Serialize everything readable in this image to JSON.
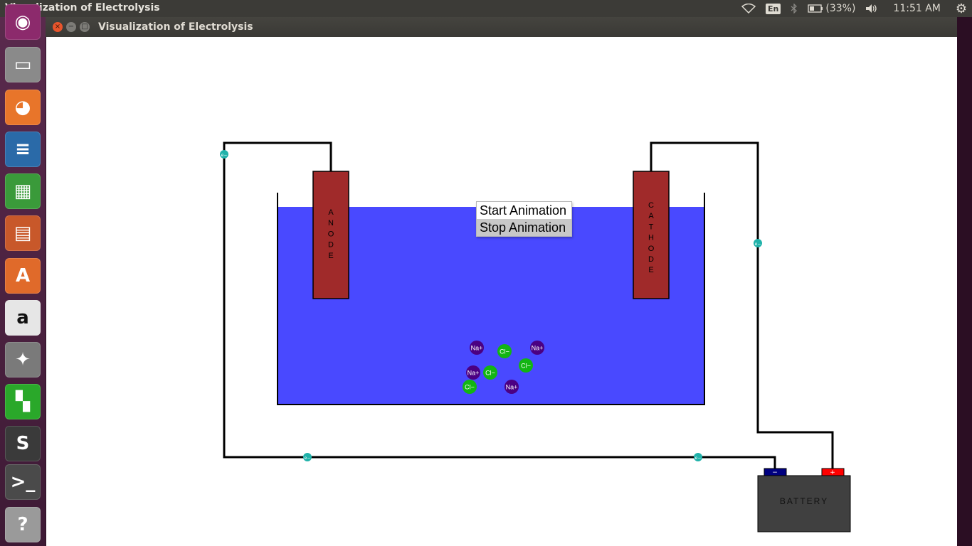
{
  "topbar": {
    "app_title": "Visualization of Electrolysis",
    "lang": "En",
    "battery": "(33%)",
    "time": "11:51 AM",
    "icons": [
      "wifi-icon",
      "bluetooth-icon",
      "battery-icon",
      "volume-icon",
      "settings-gear-icon"
    ]
  },
  "launcher": {
    "items": [
      {
        "name": "ubuntu-dash",
        "glyph": "◉",
        "color": "#8c2a6c"
      },
      {
        "name": "files",
        "glyph": "▭",
        "color": "#8a8a8a"
      },
      {
        "name": "firefox",
        "glyph": "◕",
        "color": "#e8752a"
      },
      {
        "name": "writer",
        "glyph": "≡",
        "color": "#2a6aa8"
      },
      {
        "name": "calc",
        "glyph": "▦",
        "color": "#3a9a3a"
      },
      {
        "name": "impress",
        "glyph": "▤",
        "color": "#c8582a"
      },
      {
        "name": "software-center",
        "glyph": "A",
        "color": "#e06a2a"
      },
      {
        "name": "amazon",
        "glyph": "a",
        "color": "#e6e6e6"
      },
      {
        "name": "system-settings",
        "glyph": "✦",
        "color": "#7a7a7a"
      },
      {
        "name": "game",
        "glyph": "▚",
        "color": "#2aa82a"
      },
      {
        "name": "sublime-text",
        "glyph": "S",
        "color": "#3a3a3a"
      },
      {
        "name": "terminal",
        "glyph": ">_",
        "color": "#4a4a4a"
      },
      {
        "name": "help",
        "glyph": "?",
        "color": "#9a9a9a"
      }
    ]
  },
  "window": {
    "title": "Visualization of Electrolysis",
    "controls": {
      "close": "×",
      "minimize": "−",
      "maximize": "□"
    }
  },
  "scene": {
    "anode_label": "ANODE",
    "cathode_label": "CATHODE",
    "battery_label": "BATTERY",
    "battery_minus": "−",
    "battery_plus": "+",
    "electron_label": "e−",
    "colors": {
      "electrolyte": "#4949ff",
      "electrode": "#a02a2a",
      "battery_body": "#404040",
      "battery_minus": "#000080",
      "battery_plus": "#ff0000",
      "sodium": "#4b0082",
      "chloride": "#13b513",
      "electron": "#20b2aa"
    },
    "ions": [
      {
        "label": "Na+",
        "type": "sodium"
      },
      {
        "label": "Cl−",
        "type": "chloride"
      },
      {
        "label": "Na+",
        "type": "sodium"
      },
      {
        "label": "Cl−",
        "type": "chloride"
      },
      {
        "label": "Na+",
        "type": "sodium"
      },
      {
        "label": "Cl−",
        "type": "chloride"
      },
      {
        "label": "Cl−",
        "type": "chloride"
      },
      {
        "label": "Na+",
        "type": "sodium"
      }
    ]
  },
  "menu": {
    "items": [
      "Start Animation",
      "Stop Animation"
    ],
    "selected": "Stop Animation"
  }
}
